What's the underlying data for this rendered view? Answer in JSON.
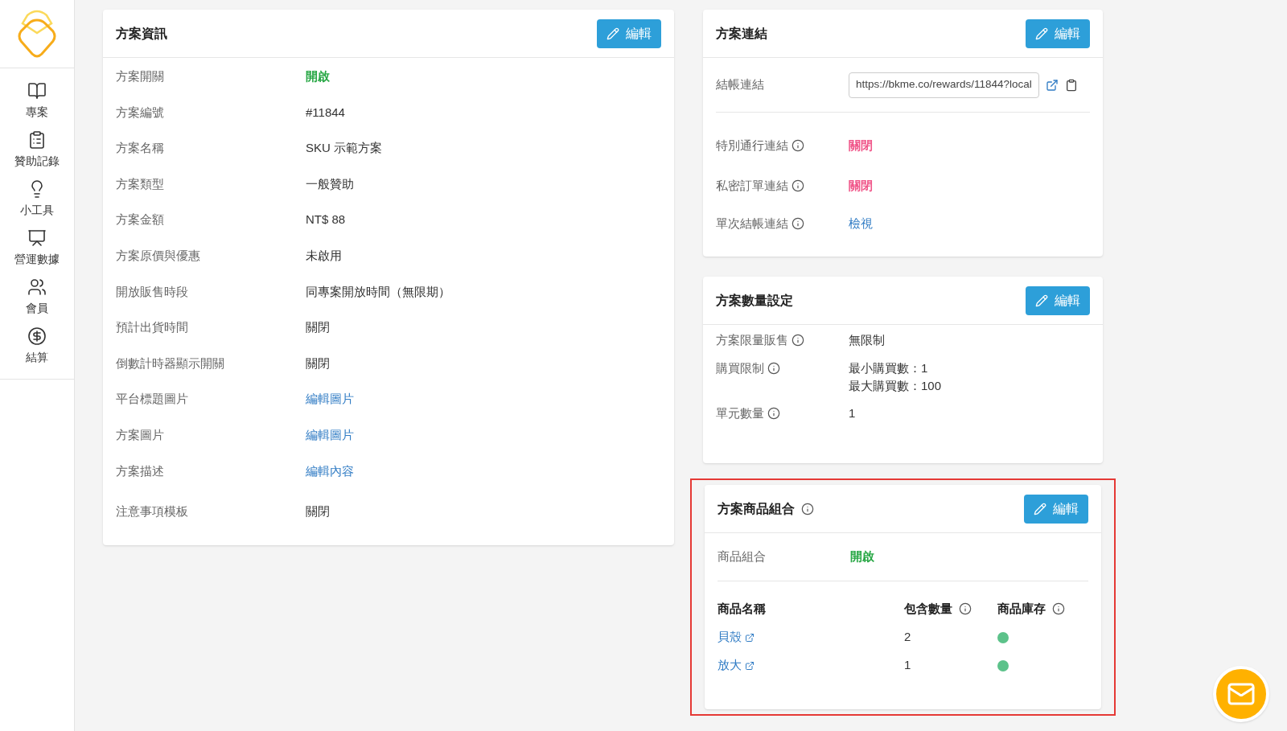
{
  "sidebar": {
    "items": [
      {
        "label": "專案"
      },
      {
        "label": "贊助記錄"
      },
      {
        "label": "小工具"
      },
      {
        "label": "營運數據"
      },
      {
        "label": "會員"
      },
      {
        "label": "結算"
      }
    ]
  },
  "plan_info": {
    "title": "方案資訊",
    "edit_button": "編輯",
    "rows": [
      {
        "label": "方案開關",
        "value": "開啟",
        "kind": "on"
      },
      {
        "label": "方案編號",
        "value": "#11844",
        "kind": "text"
      },
      {
        "label": "方案名稱",
        "value": "SKU 示範方案",
        "kind": "text"
      },
      {
        "label": "方案類型",
        "value": "一般贊助",
        "kind": "text"
      },
      {
        "label": "方案金額",
        "value": "NT$ 88",
        "kind": "text"
      },
      {
        "label": "方案原價與優惠",
        "value": "未啟用",
        "kind": "text"
      },
      {
        "label": "開放販售時段",
        "value": "同專案開放時間（無限期）",
        "kind": "text"
      },
      {
        "label": "預計出貨時間",
        "value": "關閉",
        "kind": "text"
      },
      {
        "label": "倒數計時器顯示開關",
        "value": "關閉",
        "kind": "text"
      },
      {
        "label": "平台標題圖片",
        "value": "編輯圖片",
        "kind": "link"
      },
      {
        "label": "方案圖片",
        "value": "編輯圖片",
        "kind": "link"
      },
      {
        "label": "方案描述",
        "value": "編輯內容",
        "kind": "link"
      },
      {
        "label": "注意事項模板",
        "value": "關閉",
        "kind": "text"
      }
    ]
  },
  "plan_links": {
    "title": "方案連結",
    "edit_button": "編輯",
    "checkout_link": {
      "label": "結帳連結",
      "value": "https://bkme.co/rewards/11844?local"
    },
    "rows": [
      {
        "label": "特別通行連結",
        "value": "關閉",
        "kind": "off"
      },
      {
        "label": "私密訂單連結",
        "value": "關閉",
        "kind": "off"
      },
      {
        "label": "單次結帳連結",
        "value": "檢視",
        "kind": "link"
      }
    ]
  },
  "quantity_settings": {
    "title": "方案數量設定",
    "edit_button": "編輯",
    "rows": [
      {
        "label": "方案限量販售",
        "values": [
          "無限制"
        ]
      },
      {
        "label": "購買限制",
        "values": [
          "最小購買數：1",
          "最大購買數：100"
        ]
      },
      {
        "label": "單元數量",
        "values": [
          "1"
        ]
      }
    ]
  },
  "product_bundle": {
    "title": "方案商品組合",
    "highlighted": true,
    "edit_button": "編輯",
    "status": {
      "label": "商品組合",
      "value": "開啟",
      "kind": "on"
    },
    "columns": [
      "商品名稱",
      "包含數量",
      "商品庫存"
    ],
    "rows": [
      {
        "name": "貝殼",
        "quantity": "2",
        "in_stock": true
      },
      {
        "name": "放大",
        "quantity": "1",
        "in_stock": true
      }
    ]
  }
}
